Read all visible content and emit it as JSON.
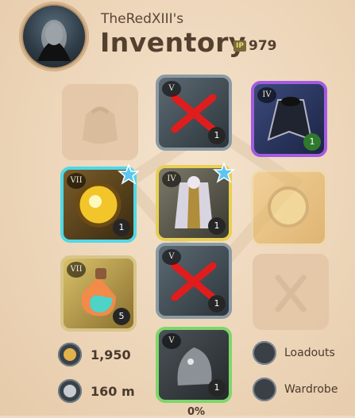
{
  "header": {
    "username": "TheRedXIII's",
    "title": "Inventory",
    "ip_badge": "IP",
    "item_power": "979"
  },
  "slots": {
    "bag": {
      "tier": "",
      "count": ""
    },
    "head": {
      "tier": "V",
      "count": "1"
    },
    "cape": {
      "tier": "IV",
      "count": "1"
    },
    "main_hand": {
      "tier": "VII",
      "count": "1"
    },
    "armor": {
      "tier": "IV",
      "count": "1"
    },
    "off_hand": {
      "tier": "",
      "count": ""
    },
    "potion": {
      "tier": "VII",
      "count": "5"
    },
    "shoes": {
      "tier": "V",
      "count": "1"
    },
    "food": {
      "tier": "",
      "count": ""
    },
    "mount": {
      "tier": "V",
      "count": "1"
    }
  },
  "currency": {
    "silver": "1,950",
    "weight": "160 m"
  },
  "actions": {
    "loadouts": "Loadouts",
    "wardrobe": "Wardrobe"
  },
  "footer": {
    "load_percent": "0%"
  },
  "colors": {
    "background": "#efd9bf",
    "purple_border": "#a35be0",
    "cyan_border": "#4fd8e8",
    "gold_border": "#e8cf55",
    "green_border": "#7ed66a"
  }
}
